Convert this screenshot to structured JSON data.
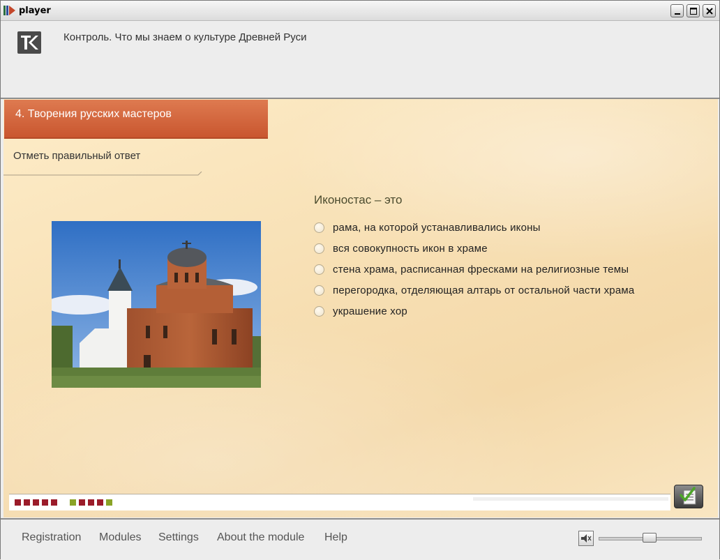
{
  "window": {
    "title": "player"
  },
  "header": {
    "logo_text": "К",
    "course_title": "Контроль. Что мы знаем о культуре Древней Руси"
  },
  "section": {
    "tab_label": "4. Творения русских мастеров",
    "instruction": "Отметь правильный ответ"
  },
  "question": {
    "text": "Иконостас – это",
    "options": [
      "рама, на которой устанавливались иконы",
      "вся совокупность икон в храме",
      "стена храма, расписанная фресками на религиозные темы",
      "перегородка, отделяющая алтарь от остальной части храма",
      "украшение хор"
    ]
  },
  "progress": {
    "blocks": [
      "#9b1c2a",
      "#9b1c2a",
      "#9b1c2a",
      "#9b1c2a",
      "#9b1c2a",
      "#8aa326",
      "#9b1c2a",
      "#9b1c2a",
      "#9b1c2a",
      "#8aa326"
    ]
  },
  "footer": {
    "menu": [
      "Registration",
      "Modules",
      "Settings",
      "About the module",
      "Help"
    ],
    "volume_level": 0.5
  },
  "colors": {
    "accent": "#d4653b",
    "correct": "#8aa326",
    "wrong": "#9b1c2a"
  }
}
